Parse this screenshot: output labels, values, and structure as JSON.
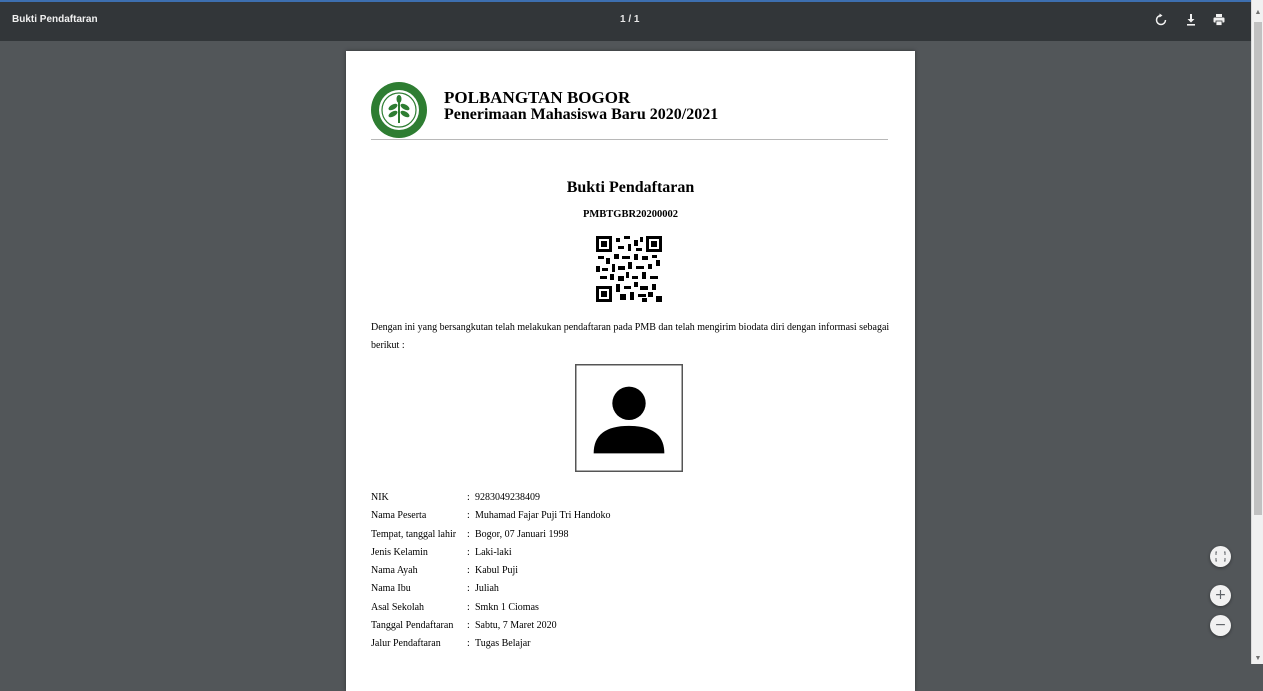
{
  "toolbar": {
    "title": "Bukti Pendaftaran",
    "page_indicator": "1 / 1",
    "rotate_icon": "rotate-icon",
    "download_icon": "download-icon",
    "print_icon": "print-icon"
  },
  "document": {
    "institution": "POLBANGTAN BOGOR",
    "subtitle": "Penerimaan Mahasiswa Baru 2020/2021",
    "title": "Bukti Pendaftaran",
    "registration_number": "PMBTGBR20200002",
    "statement": "Dengan ini yang bersangkutan telah melakukan pendaftaran pada PMB dan telah mengirim biodata diri dengan informasi sebagai berikut :",
    "biodata": [
      {
        "label": "NIK",
        "value": "9283049238409"
      },
      {
        "label": "Nama Peserta",
        "value": "Muhamad Fajar Puji Tri Handoko"
      },
      {
        "label": "Tempat, tanggal lahir",
        "value": "Bogor, 07 Januari 1998"
      },
      {
        "label": "Jenis Kelamin",
        "value": "Laki-laki"
      },
      {
        "label": "Nama Ayah",
        "value": "Kabul Puji"
      },
      {
        "label": "Nama Ibu",
        "value": "Juliah"
      },
      {
        "label": "Asal Sekolah",
        "value": "Smkn 1 Ciomas"
      },
      {
        "label": "Tanggal Pendaftaran",
        "value": "Sabtu, 7 Maret 2020"
      },
      {
        "label": "Jalur Pendaftaran",
        "value": "Tugas Belajar"
      }
    ],
    "logo_color": "#2e7d32"
  },
  "zoom_controls": {
    "fit_icon": "fit-to-page-icon",
    "zoom_in_label": "+",
    "zoom_out_label": "−"
  }
}
